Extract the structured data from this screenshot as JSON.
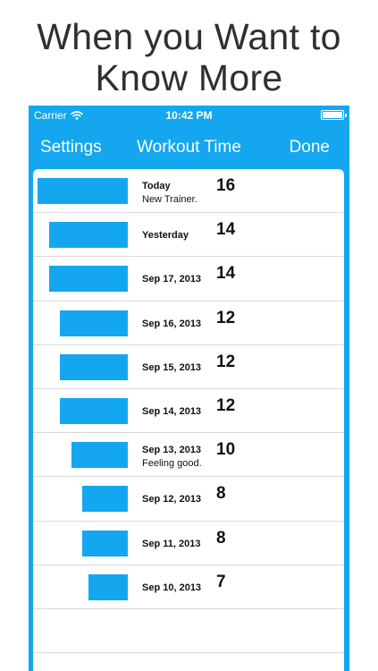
{
  "headline": {
    "line1": "When you Want to",
    "line2": "Know More"
  },
  "status": {
    "carrier": "Carrier",
    "time": "10:42 PM"
  },
  "nav": {
    "left": "Settings",
    "title": "Workout Time",
    "right": "Done"
  },
  "icons": {
    "wifi": "wifi-icon",
    "battery": "battery-icon"
  },
  "colors": {
    "accent": "#14a7ef",
    "text": "#111111",
    "headline": "#2f2f2f"
  },
  "rows": [
    {
      "date": "Today",
      "note": "New Trainer.",
      "value": "16"
    },
    {
      "date": "Yesterday",
      "note": "",
      "value": "14"
    },
    {
      "date": "Sep 17, 2013",
      "note": "",
      "value": "14"
    },
    {
      "date": "Sep 16, 2013",
      "note": "",
      "value": "12"
    },
    {
      "date": "Sep 15, 2013",
      "note": "",
      "value": "12"
    },
    {
      "date": "Sep 14, 2013",
      "note": "",
      "value": "12"
    },
    {
      "date": "Sep 13, 2013",
      "note": "Feeling good.",
      "value": "10"
    },
    {
      "date": "Sep 12, 2013",
      "note": "",
      "value": "8"
    },
    {
      "date": "Sep 11, 2013",
      "note": "",
      "value": "8"
    },
    {
      "date": "Sep 10, 2013",
      "note": "",
      "value": "7"
    }
  ]
}
